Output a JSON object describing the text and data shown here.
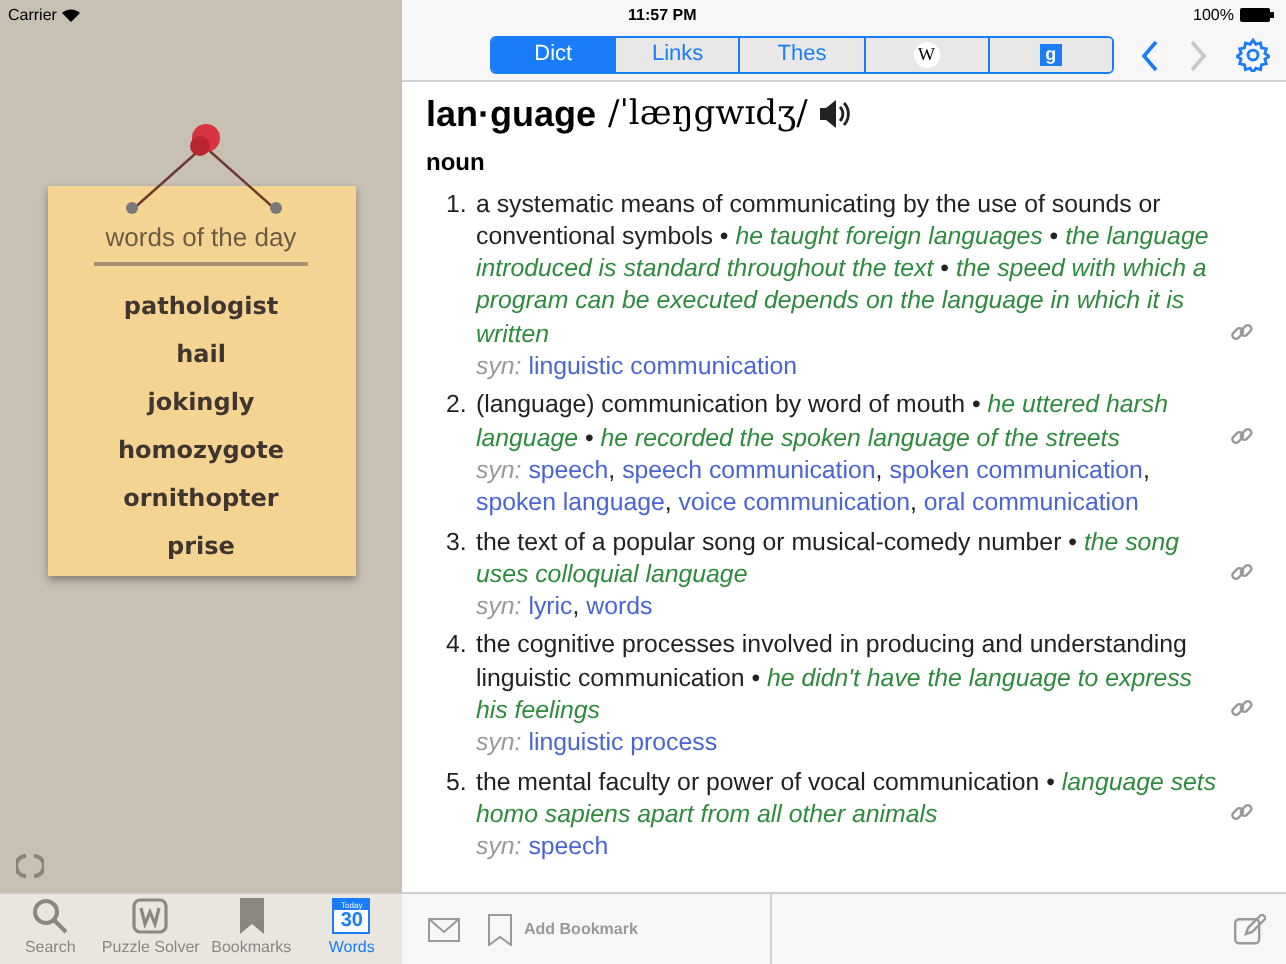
{
  "status_bar": {
    "carrier": "Carrier",
    "time": "11:57 PM",
    "battery": "100%"
  },
  "segments": [
    {
      "label": "Dict",
      "kind": "text",
      "selected": true
    },
    {
      "label": "Links",
      "kind": "text",
      "selected": false
    },
    {
      "label": "Thes",
      "kind": "text",
      "selected": false
    },
    {
      "label": "W",
      "kind": "wiki",
      "selected": false
    },
    {
      "label": "g",
      "kind": "google",
      "selected": false
    }
  ],
  "nav": {
    "back_disabled": false,
    "forward_disabled": true
  },
  "note": {
    "title": "words of the day",
    "words": [
      "pathologist",
      "hail",
      "jokingly",
      "homozygote",
      "ornithopter",
      "prise"
    ]
  },
  "entry": {
    "headword": "lan·guage",
    "pronunciation": "/ˈlæŋgwɪdʒ/",
    "part_of_speech": "noun",
    "example_separator": "•",
    "senses": [
      {
        "number": "1.",
        "definition": "a systematic means of communicating by the use of sounds or conventional symbols",
        "examples": [
          "he taught foreign languages",
          "the language introduced is standard throughout the text",
          "the speed with which a program can be executed depends on the language in which it is written"
        ],
        "syn_label": "syn:",
        "synonyms": [
          {
            "text": "linguistic communication"
          }
        ]
      },
      {
        "number": "2.",
        "definition": "(language) communication by word of mouth",
        "examples": [
          "he uttered harsh language",
          "he recorded the spoken language of the streets"
        ],
        "syn_label": "syn:",
        "synonyms": [
          {
            "text": "speech",
            "separator": ","
          },
          {
            "text": "speech communication",
            "separator": ","
          },
          {
            "text": "spoken communication",
            "separator": ","
          },
          {
            "text": "spoken language",
            "separator": ","
          },
          {
            "text": "voice communication",
            "separator": ","
          },
          {
            "text": "oral communication"
          }
        ]
      },
      {
        "number": "3.",
        "definition": "the text of a popular song or musical-comedy number",
        "examples": [
          "the song uses colloquial language"
        ],
        "syn_label": "syn:",
        "synonyms": [
          {
            "text": "lyric",
            "separator": ","
          },
          {
            "text": "words"
          }
        ]
      },
      {
        "number": "4.",
        "definition": "the cognitive processes involved in producing and understanding linguistic communication",
        "examples": [
          "he didn't have the language to express his feelings"
        ],
        "syn_label": "syn:",
        "synonyms": [
          {
            "text": "linguistic process"
          }
        ]
      },
      {
        "number": "5.",
        "definition": "the mental faculty or power of vocal communication",
        "examples": [
          "language sets homo sapiens apart from all other animals"
        ],
        "syn_label": "syn:",
        "synonyms": [
          {
            "text": "speech"
          }
        ]
      }
    ]
  },
  "tab_bar": [
    {
      "label": "Search",
      "kind": "search",
      "selected": false
    },
    {
      "label": "Puzzle Solver",
      "kind": "puzzle",
      "selected": false
    },
    {
      "label": "Bookmarks",
      "kind": "bookmarks",
      "selected": false
    },
    {
      "label": "Words",
      "kind": "calendar",
      "selected": true,
      "badge_top": "Today",
      "badge_day": "30"
    }
  ],
  "bottom_toolbar": {
    "add_bookmark": "Add Bookmark"
  }
}
